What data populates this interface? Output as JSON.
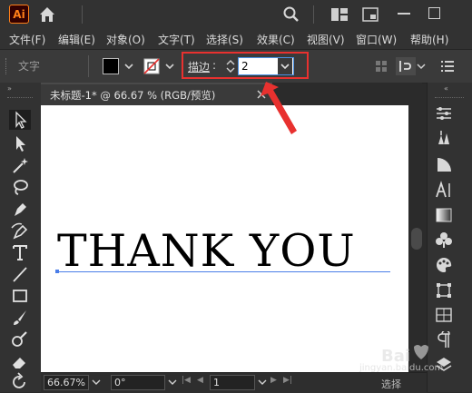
{
  "app": {
    "logo_text": "Ai",
    "accent": "#ff7f18"
  },
  "menu": {
    "items": [
      "文件(F)",
      "编辑(E)",
      "对象(O)",
      "文字(T)",
      "选择(S)",
      "效果(C)",
      "视图(V)",
      "窗口(W)",
      "帮助(H)"
    ]
  },
  "control": {
    "tool_label": "文字",
    "fill_color": "#000000",
    "stroke_label": "描边",
    "stroke_colon": ":",
    "stroke_value": "2",
    "highlight_color": "#e8312f"
  },
  "document": {
    "tab_title": "未标题-1* @ 66.67 % (RGB/预览)",
    "text": "THANK YOU",
    "text_color": "#000000",
    "baseline_color": "#4a7de8"
  },
  "status": {
    "zoom": "66.67%",
    "rotation": "0°",
    "artboard": "1",
    "mode": "选择"
  },
  "watermark": {
    "text": "jingyan.baidu.com"
  },
  "icons": {
    "title": [
      "home-icon",
      "search-icon",
      "workspace-icon",
      "window-icon"
    ],
    "tools": [
      "selection-tool-icon",
      "direct-selection-tool-icon",
      "magic-wand-icon",
      "lasso-icon",
      "pen-tool-icon",
      "curvature-tool-icon",
      "type-tool-icon",
      "line-tool-icon",
      "rectangle-tool-icon",
      "paintbrush-icon",
      "shaper-tool-icon",
      "eraser-icon",
      "rotate-tool-icon"
    ],
    "panels": [
      "properties-icon",
      "brushes-icon",
      "gradient-pie-icon",
      "character-icon",
      "gradient-icon",
      "symbols-icon",
      "color-palette-icon",
      "transform-icon",
      "align-icon",
      "paragraph-icon",
      "layers-icon"
    ]
  }
}
